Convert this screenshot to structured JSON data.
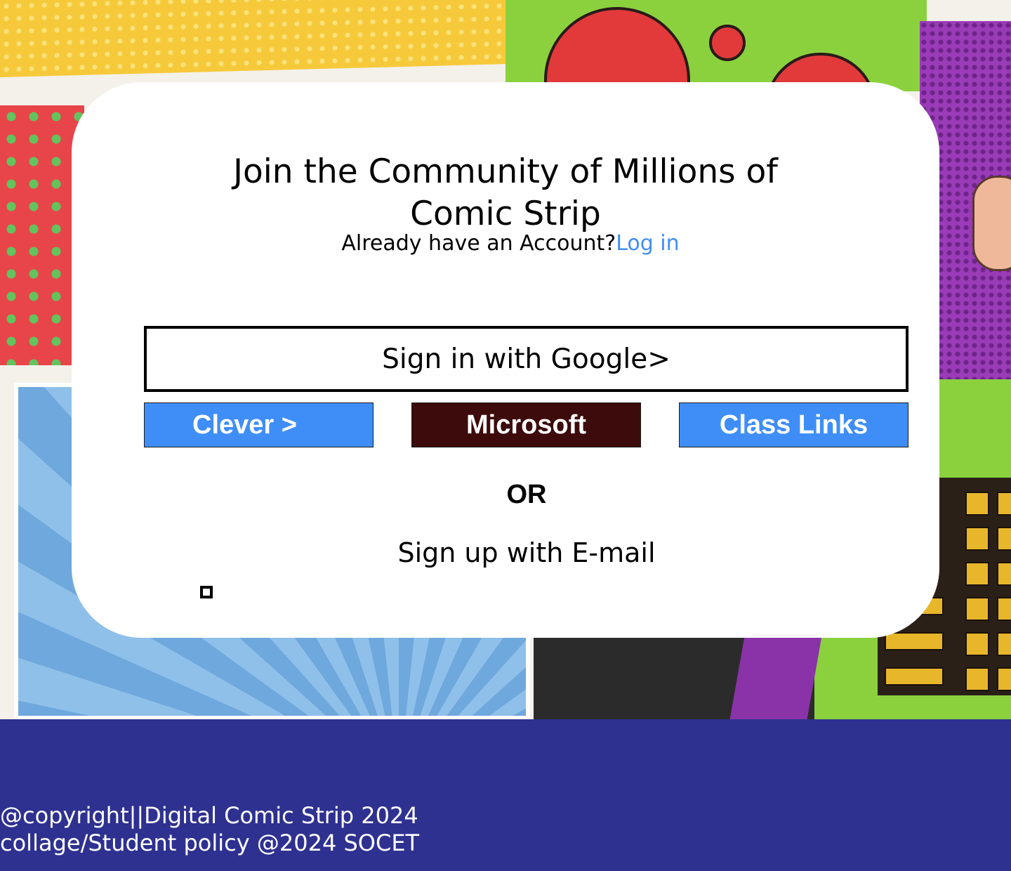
{
  "card": {
    "headline_line1": "Join the Community of Millions of",
    "headline_line2": "Comic Strip",
    "account_prompt": "Already have an Account?",
    "login_link": "Log in"
  },
  "buttons": {
    "google": "Sign in with Google>",
    "clever": "Clever >",
    "microsoft": "Microsoft",
    "class_links": "Class Links"
  },
  "divider": {
    "or": "OR"
  },
  "email_signup": "Sign up with E-mail",
  "footer": {
    "line1": "@copyright||Digital Comic Strip 2024",
    "line2": "collage/Student policy @2024 SOCET"
  },
  "colors": {
    "accent_blue": "#3f8ef7",
    "microsoft_brown": "#3d0b0b",
    "link_blue": "#3f8ef0",
    "footer_bg": "#2e3190"
  }
}
